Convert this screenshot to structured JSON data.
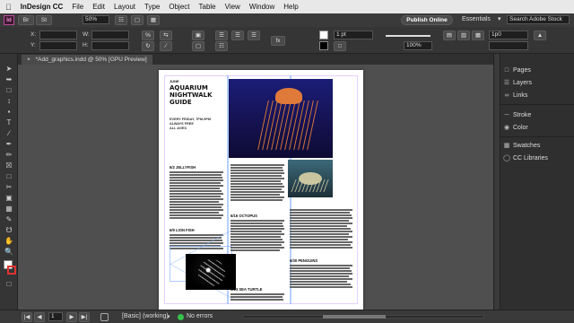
{
  "menubar": {
    "apple_icon": "apple-icon",
    "app": "InDesign CC",
    "items": [
      "File",
      "Edit",
      "Layout",
      "Type",
      "Object",
      "Table",
      "View",
      "Window",
      "Help"
    ]
  },
  "appbar": {
    "logo": "Id",
    "zoom": "50%",
    "publish": "Publish Online",
    "workspace": "Essentials",
    "search_placeholder": "Search Adobe Stock"
  },
  "control": {
    "x_label": "X:",
    "y_label": "Y:",
    "w_label": "W:",
    "h_label": "H:",
    "stroke_weight": "1 pt",
    "opacity": "100%",
    "size_value": "1p0"
  },
  "document": {
    "tab_title": "*Add_graphics.indd @ 50% [GPU Preview]",
    "page_title_lines": [
      "AQUARIUM",
      "NIGHTWALK",
      "GUIDE"
    ],
    "month": "JUNE",
    "subtitle_lines": [
      "EVERY FRIDAY, 7PM-9PM",
      "ALWAYS FREE",
      "ALL AGES"
    ],
    "section1": "6/2 JELLYFISH",
    "section2": "6/9 LION FISH",
    "section3": "6/16 OCTOPUS",
    "section4": "6/23 SEA TURTLE",
    "section5": "6/30 PENGUINS"
  },
  "panels": [
    {
      "label": "Pages",
      "icon": "pages-icon"
    },
    {
      "label": "Layers",
      "icon": "layers-icon"
    },
    {
      "label": "Links",
      "icon": "links-icon"
    },
    {
      "label": "Stroke",
      "icon": "stroke-icon"
    },
    {
      "label": "Color",
      "icon": "color-icon"
    },
    {
      "label": "Swatches",
      "icon": "swatches-icon"
    },
    {
      "label": "CC Libraries",
      "icon": "cc-libraries-icon"
    }
  ],
  "status": {
    "page_number": "1",
    "style": "[Basic] (working)",
    "errors": "No errors"
  },
  "colors": {
    "accent_blue": "#2d6de0",
    "ok_green": "#37c14d",
    "jelly_bg": "#1b1a6e",
    "jelly_orange": "#e0793a"
  }
}
